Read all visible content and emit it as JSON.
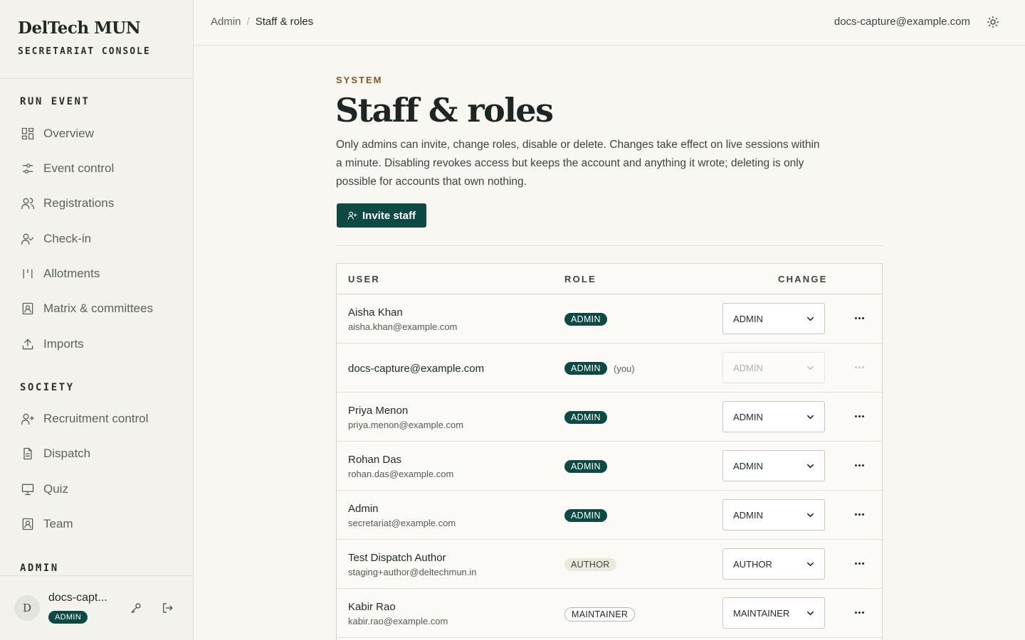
{
  "brand": {
    "title": "DelTech MUN",
    "subtitle": "SECRETARIAT CONSOLE"
  },
  "sidebar": {
    "sections": [
      {
        "label": "RUN EVENT"
      },
      {
        "label": "SOCIETY"
      },
      {
        "label": "ADMIN"
      }
    ],
    "items": [
      {
        "label": "Overview",
        "icon": "grid-icon"
      },
      {
        "label": "Event control",
        "icon": "sliders-icon"
      },
      {
        "label": "Registrations",
        "icon": "users-icon"
      },
      {
        "label": "Check-in",
        "icon": "user-check-icon"
      },
      {
        "label": "Allotments",
        "icon": "columns-icon"
      },
      {
        "label": "Matrix & committees",
        "icon": "contact-icon"
      },
      {
        "label": "Imports",
        "icon": "upload-icon"
      },
      {
        "label": "Recruitment control",
        "icon": "user-plus-icon"
      },
      {
        "label": "Dispatch",
        "icon": "file-text-icon"
      },
      {
        "label": "Quiz",
        "icon": "presentation-icon"
      },
      {
        "label": "Team",
        "icon": "contact-icon"
      }
    ]
  },
  "user": {
    "initial": "D",
    "name": "docs-capt...",
    "role": "ADMIN"
  },
  "topbar": {
    "breadcrumb": [
      "Admin",
      "Staff & roles"
    ],
    "separator": "/",
    "email": "docs-capture@example.com"
  },
  "page": {
    "eyebrow": "SYSTEM",
    "title": "Staff & roles",
    "description": "Only admins can invite, change roles, disable or delete. Changes take effect on live sessions within a minute. Disabling revokes access but keeps the account and anything it wrote; deleting is only possible for accounts that own nothing.",
    "invite_label": "Invite staff"
  },
  "table": {
    "headers": {
      "user": "USER",
      "role": "ROLE",
      "change": "CHANGE"
    },
    "you_label": "(you)",
    "rows": [
      {
        "name": "Aisha Khan",
        "email": "aisha.khan@example.com",
        "role": "ADMIN",
        "change": "ADMIN"
      },
      {
        "name": "docs-capture@example.com",
        "email": "",
        "role": "ADMIN",
        "change": "ADMIN"
      },
      {
        "name": "Priya Menon",
        "email": "priya.menon@example.com",
        "role": "ADMIN",
        "change": "ADMIN"
      },
      {
        "name": "Rohan Das",
        "email": "rohan.das@example.com",
        "role": "ADMIN",
        "change": "ADMIN"
      },
      {
        "name": "Admin",
        "email": "secretariat@example.com",
        "role": "ADMIN",
        "change": "ADMIN"
      },
      {
        "name": "Test Dispatch Author",
        "email": "staging+author@deltechmun.in",
        "role": "AUTHOR",
        "change": "AUTHOR"
      },
      {
        "name": "Kabir Rao",
        "email": "kabir.rao@example.com",
        "role": "MAINTAINER",
        "change": "MAINTAINER"
      }
    ]
  },
  "colors": {
    "accent": "#0d4a43",
    "eyebrow": "#7a5a1d",
    "background": "#f9f7f2"
  }
}
